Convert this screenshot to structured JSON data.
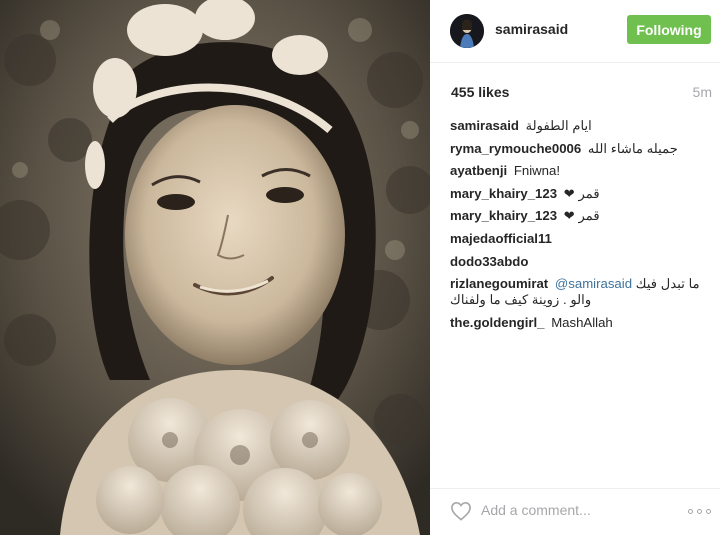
{
  "post": {
    "username": "samirasaid",
    "follow_label": "Following",
    "likes": "455 likes",
    "time": "5m",
    "photo_icon": "vintage-portrait-photo"
  },
  "comments": [
    {
      "user": "samirasaid",
      "text": "ايام الطفولة ",
      "rtl": true
    },
    {
      "user": "ryma_rymouche0006",
      "text": "جميله ماشاء الله",
      "rtl": true
    },
    {
      "user": "ayatbenji",
      "text": "Fniwna!",
      "rtl": false
    },
    {
      "user": "mary_khairy_123",
      "text": "قمر ❤",
      "rtl": true
    },
    {
      "user": "mary_khairy_123",
      "text": "قمر ❤",
      "rtl": true
    },
    {
      "user": "majedaofficial11",
      "text": "",
      "rtl": false
    },
    {
      "user": "dodo33abdo",
      "text": "",
      "rtl": false
    },
    {
      "user": "rizlanegoumirat",
      "mention": "@samirasaid",
      "text": "ما تبدل فيك والو . زوينة كيف ما ولفناك",
      "rtl": true
    },
    {
      "user": "the.goldengirl_",
      "text": "MashAllah ",
      "rtl": false
    }
  ],
  "footer": {
    "add_comment_placeholder": "Add a comment...",
    "like_icon": "heart-outline-icon",
    "more_icon": "more-options-icon"
  },
  "colors": {
    "follow_button": "#70c050",
    "mention": "#3f729b",
    "muted": "#a5a7aa"
  }
}
